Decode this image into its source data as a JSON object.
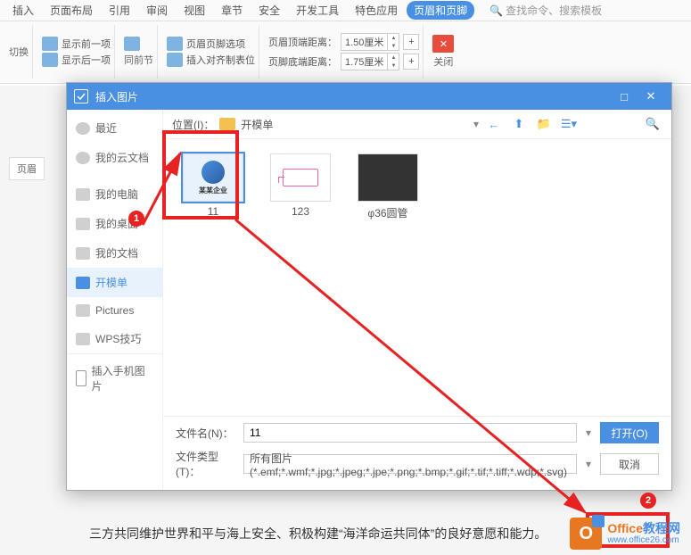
{
  "ribbon": {
    "tabs": [
      "插入",
      "页面布局",
      "引用",
      "审阅",
      "视图",
      "章节",
      "安全",
      "开发工具",
      "特色应用",
      "页眉和页脚"
    ],
    "active_tab": "页眉和页脚",
    "search_icon": "🔍",
    "search_placeholder": "查找命令、搜索模板",
    "show_prev": "显示前一项",
    "show_next": "显示后一项",
    "same_section": "同前节",
    "header_footer_options": "页眉页脚选项",
    "insert_align_pos": "插入对齐制表位",
    "header_top_dist": "页眉顶端距离：",
    "footer_bottom_dist": "页脚底端距离：",
    "dist_header_val": "1.50厘米",
    "dist_footer_val": "1.75厘米",
    "switch": "切换",
    "close": "关闭"
  },
  "page_nav": {
    "header_tab": "页眉"
  },
  "dialog": {
    "title": "插入图片",
    "location_label": "位置(I)：",
    "current_folder": "开模单",
    "sidebar": {
      "recent": "最近",
      "my_cloud": "我的云文档",
      "my_computer": "我的电脑",
      "my_desktop": "我的桌面",
      "my_docs": "我的文档",
      "kaimodan": "开模单",
      "pictures": "Pictures",
      "wps_tips": "WPS技巧"
    },
    "files": {
      "f1": {
        "name": "11",
        "logo_text": "某某企业"
      },
      "f2": {
        "name": "123"
      },
      "f3": {
        "name": "φ36圆管"
      }
    },
    "filename_label": "文件名(N)：",
    "filename_value": "11",
    "filetype_label": "文件类型(T)：",
    "filetype_value": "所有图片(*.emf;*.wmf;*.jpg;*.jpeg;*.jpe;*.png;*.bmp;*.gif;*.tif;*.tiff;*.wdp;*.svg)",
    "open_btn": "打开(O)",
    "cancel_btn": "取消",
    "insert_phone": "插入手机图片"
  },
  "doc_text": "三方共同维护世界和平与海上安全、积极构建“海洋命运共同体”的良好意愿和能力。",
  "annotations": {
    "b1": "1",
    "b2": "2"
  },
  "watermark": {
    "brand1": "Office",
    "brand2": "教程网",
    "url": "www.office26.com"
  }
}
